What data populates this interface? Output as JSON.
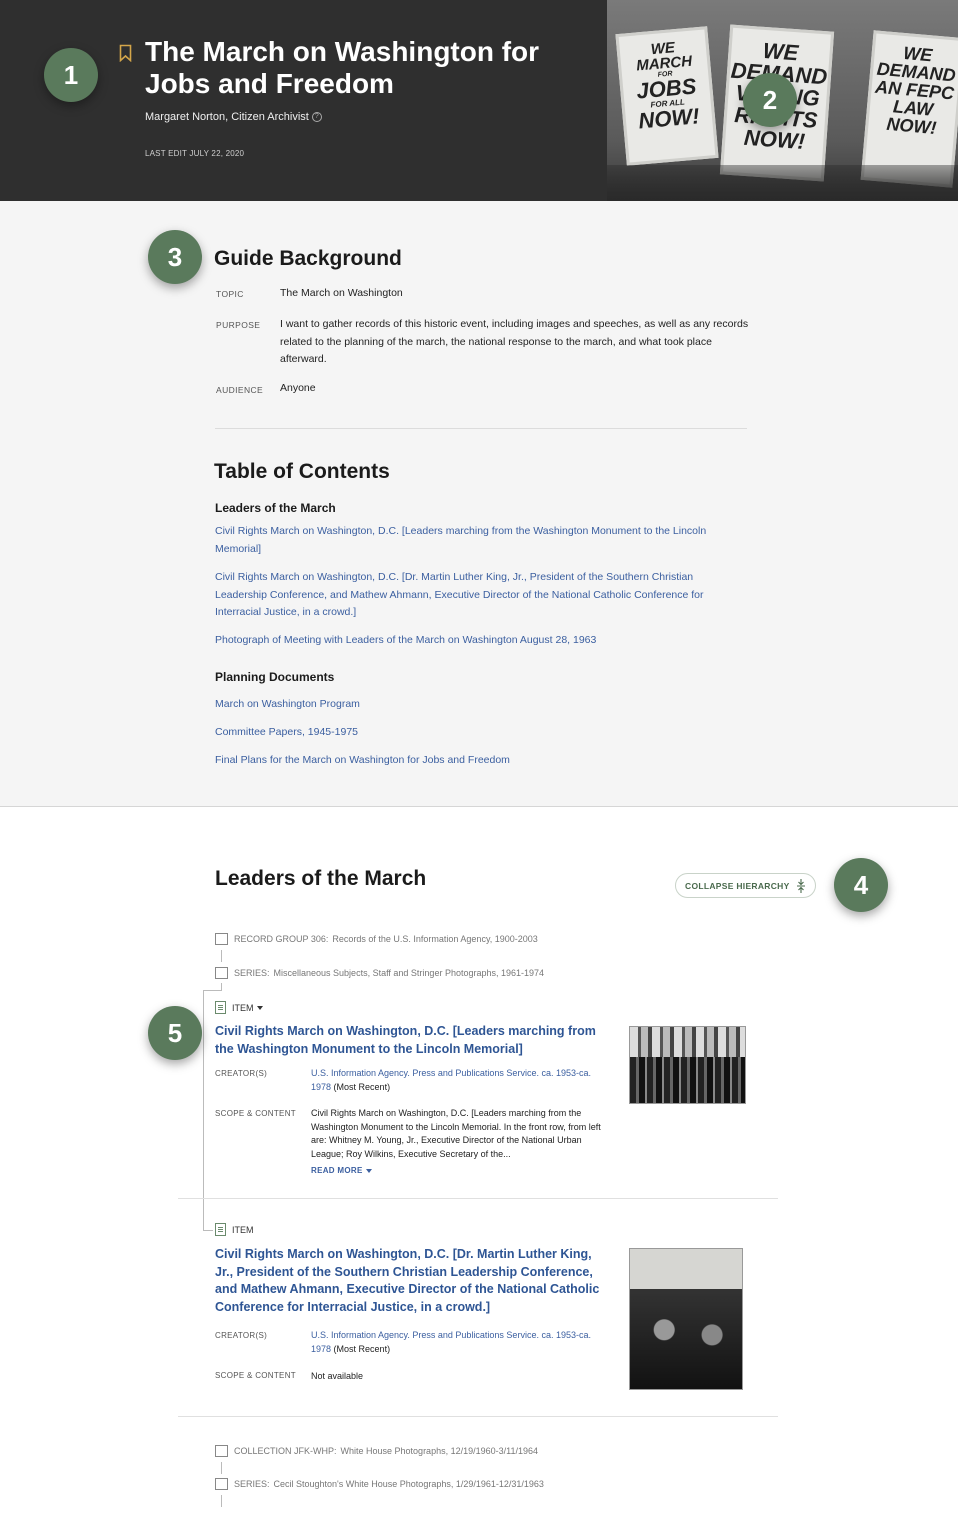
{
  "header": {
    "title": "The March on Washington for Jobs and Freedom",
    "author": "Margaret Norton, Citizen Archivist",
    "last_edit": "LAST EDIT JULY 22, 2020",
    "photo_signs": [
      "WE MARCH FOR JOBS FOR ALL NOW!",
      "WE DEMAND VOTING RIGHTS NOW!",
      "WE DEMAND AN FEPC LAW NOW!"
    ]
  },
  "badges": [
    "1",
    "2",
    "3",
    "4",
    "5"
  ],
  "guide": {
    "heading": "Guide Background",
    "topic_label": "TOPIC",
    "topic": "The March on Washington",
    "purpose_label": "PURPOSE",
    "purpose": "I want to gather records of this historic event, including images and speeches, as well as any records related to the planning of the march, the national response to the march, and what took place afterward.",
    "audience_label": "AUDIENCE",
    "audience": "Anyone"
  },
  "toc": {
    "heading": "Table of Contents",
    "sections": [
      {
        "title": "Leaders of the March",
        "links": [
          "Civil Rights March on Washington, D.C. [Leaders marching from the Washington Monument to the Lincoln Memorial]",
          "Civil Rights March on Washington, D.C. [Dr. Martin Luther King, Jr., President of the Southern Christian Leadership Conference, and Mathew Ahmann, Executive Director of the National Catholic Conference for Interracial Justice, in a crowd.]",
          "Photograph of Meeting with Leaders of the March on Washington August 28, 1963"
        ]
      },
      {
        "title": "Planning Documents",
        "links": [
          "March on Washington Program",
          "Committee Papers, 1945-1975",
          "Final Plans for the March on Washington for Jobs and Freedom"
        ]
      }
    ]
  },
  "leaders": {
    "heading": "Leaders of the March",
    "collapse_label": "COLLAPSE HIERARCHY",
    "record_group_label": "RECORD GROUP 306:",
    "record_group": "Records of the U.S. Information Agency, 1900-2003",
    "series_label": "SERIES:",
    "series": "Miscellaneous Subjects, Staff and Stringer Photographs, 1961-1974",
    "items": [
      {
        "tag": "ITEM",
        "title": "Civil Rights March on Washington, D.C. [Leaders marching from the Washington Monument to the Lincoln Memorial]",
        "creator_label": "CREATOR(S)",
        "creator": "U.S. Information Agency. Press and Publications Service. ca. 1953-ca. 1978",
        "creator_note": "(Most Recent)",
        "scope_label": "SCOPE & CONTENT",
        "scope": "Civil Rights March on Washington, D.C. [Leaders marching from the Washington Monument to the Lincoln Memorial. In the front row, from left are: Whitney M. Young, Jr., Executive Director of the National Urban League; Roy Wilkins, Executive Secretary of the...",
        "read_more": "READ MORE"
      },
      {
        "tag": "ITEM",
        "title": "Civil Rights March on Washington, D.C. [Dr. Martin Luther King, Jr., President of the Southern Christian Leadership Conference, and Mathew Ahmann, Executive Director of the National Catholic Conference for Interracial Justice, in a crowd.]",
        "creator_label": "CREATOR(S)",
        "creator": "U.S. Information Agency. Press and Publications Service. ca. 1953-ca. 1978",
        "creator_note": "(Most Recent)",
        "scope_label": "SCOPE & CONTENT",
        "scope": "Not available"
      }
    ],
    "collection_label": "COLLECTION JFK-WHP:",
    "collection": "White House Photographs, 12/19/1960-3/11/1964",
    "series2_label": "SERIES:",
    "series2": "Cecil Stoughton's White House Photographs, 1/29/1961-12/31/1963"
  }
}
